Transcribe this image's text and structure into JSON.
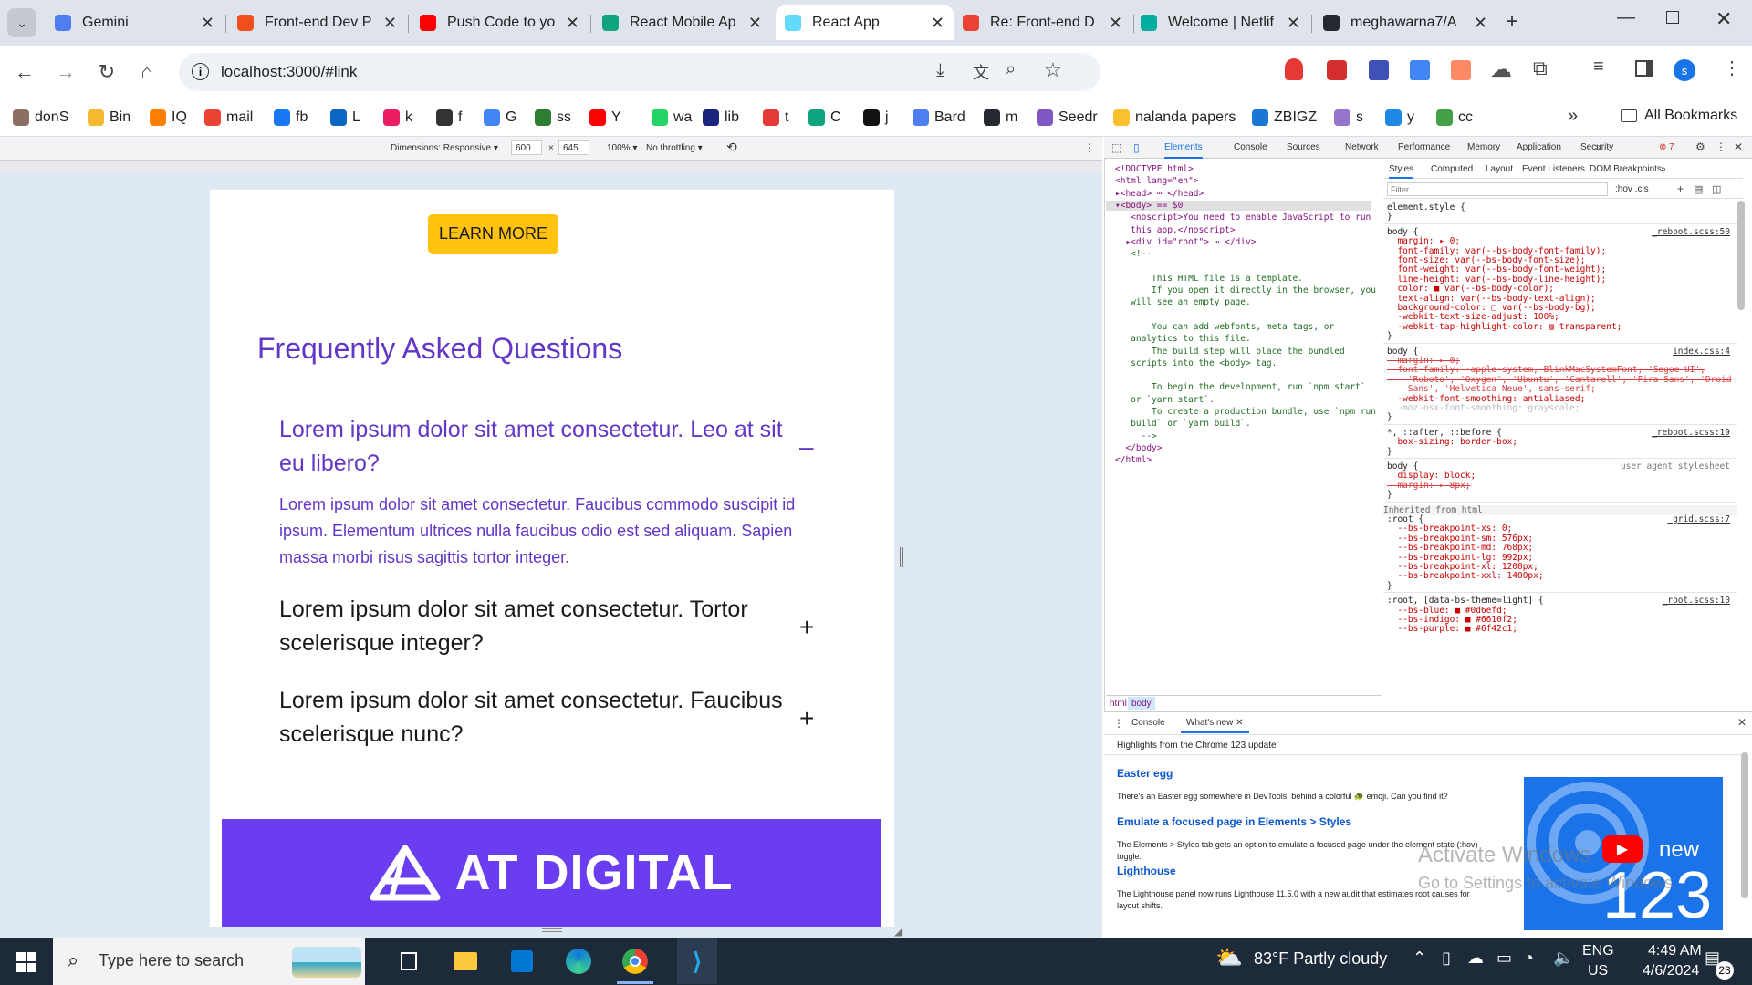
{
  "tabs": [
    {
      "label": "Gemini",
      "icon": "gemini-icon",
      "color": "#4f7df2"
    },
    {
      "label": "Front-end Dev P",
      "icon": "figma-icon",
      "color": "#f24e1e"
    },
    {
      "label": "Push Code to yo",
      "icon": "youtube-icon",
      "color": "#ff0000"
    },
    {
      "label": "React Mobile Ap",
      "icon": "chatgpt-icon",
      "color": "#10a37f"
    },
    {
      "label": "React App",
      "icon": "react-icon",
      "color": "#61dafb"
    },
    {
      "label": "Re: Front-end D",
      "icon": "gmail-icon",
      "color": "#ea4335"
    },
    {
      "label": "Welcome | Netlif",
      "icon": "netlify-icon",
      "color": "#00ad9f"
    },
    {
      "label": "meghawarna7/A",
      "icon": "github-icon",
      "color": "#24292f"
    }
  ],
  "tab_close": "✕",
  "new_tab": "+",
  "address": {
    "url": "localhost:3000/#link"
  },
  "bookmarks": [
    {
      "label": "donS",
      "color": "#8d6e63"
    },
    {
      "label": "Bin",
      "color": "#f3ba2f"
    },
    {
      "label": "IQ",
      "color": "#ff7f00"
    },
    {
      "label": "mail",
      "color": "#ea4335"
    },
    {
      "label": "fb",
      "color": "#1877f2"
    },
    {
      "label": "L",
      "color": "#0a66c2"
    },
    {
      "label": "k",
      "color": "#e91e63"
    },
    {
      "label": "f",
      "color": "#333333"
    },
    {
      "label": "G",
      "color": "#4285f4"
    },
    {
      "label": "ss",
      "color": "#2e7d32"
    },
    {
      "label": "Y",
      "color": "#ff0000"
    },
    {
      "label": "wa",
      "color": "#25d366"
    },
    {
      "label": "lib",
      "color": "#1a237e"
    },
    {
      "label": "t",
      "color": "#e53935"
    },
    {
      "label": "C",
      "color": "#10a37f"
    },
    {
      "label": "j",
      "color": "#111111"
    },
    {
      "label": "Bard",
      "color": "#4f7df2"
    },
    {
      "label": "m",
      "color": "#24292f"
    },
    {
      "label": "Seedr",
      "color": "#7e57c2"
    },
    {
      "label": "nalanda papers",
      "color": "#fbc02d"
    },
    {
      "label": "ZBIGZ",
      "color": "#1976d2"
    },
    {
      "label": "s",
      "color": "#9575cd"
    },
    {
      "label": "y",
      "color": "#1e88e5"
    },
    {
      "label": "cc",
      "color": "#43a047"
    }
  ],
  "all_bookmarks": "All Bookmarks",
  "device_toolbar": {
    "dimensions": "Dimensions: Responsive ▾",
    "width": "600",
    "x": "×",
    "height": "645",
    "zoom": "100% ▾",
    "throttle": "No throttling ▾"
  },
  "page": {
    "learn_more": "LEARN MORE",
    "faq_title": "Frequently Asked Questions",
    "faq": [
      {
        "q": "Lorem ipsum dolor sit amet consectetur. Leo at sit eu libero?",
        "sym": "–",
        "open": true
      },
      {
        "q": "Lorem ipsum dolor sit amet consectetur. Tortor scelerisque integer?",
        "sym": "+",
        "open": false
      },
      {
        "q": "Lorem ipsum dolor sit amet consectetur. Faucibus scelerisque nunc?",
        "sym": "+",
        "open": false
      }
    ],
    "faq_answer": "Lorem ipsum dolor sit amet consectetur. Faucibus commodo suscipit id ipsum. Elementum ultrices nulla faucibus odio est sed aliquam. Sapien massa morbi risus sagittis tortor integer.",
    "banner_text": "AT DIGITAL"
  },
  "devtools": {
    "tabs": [
      "Elements",
      "Console",
      "Sources",
      "Network",
      "Performance",
      "Memory",
      "Application",
      "Security"
    ],
    "more": "»",
    "errors": "7",
    "styles_tabs": [
      "Styles",
      "Computed",
      "Layout",
      "Event Listeners",
      "DOM Breakpoints",
      "»"
    ],
    "filter_placeholder": "Filter",
    "filter_opts": ":hov .cls",
    "elements_lines": [
      "<!DOCTYPE html>",
      "<html lang=\"en\">",
      "▸<head> ⋯ </head>",
      "▾<body> == $0",
      "   <noscript>You need to enable JavaScript to run",
      "   this app.</noscript>",
      "  ▸<div id=\"root\"> ⋯ </div>",
      "   <!--",
      "",
      "       This HTML file is a template.",
      "       If you open it directly in the browser, you",
      "   will see an empty page.",
      "",
      "       You can add webfonts, meta tags, or",
      "   analytics to this file.",
      "       The build step will place the bundled",
      "   scripts into the <body> tag.",
      "",
      "       To begin the development, run `npm start`",
      "   or `yarn start`.",
      "       To create a production bundle, use `npm run",
      "   build` or `yarn build`.",
      "     -->",
      "  </body>",
      "</html>"
    ],
    "breadcrumb": [
      "html",
      "body"
    ],
    "style_rules": [
      {
        "text": "element.style {",
        "src": "",
        "cls": "sel"
      },
      {
        "text": "}",
        "src": "",
        "cls": "sel"
      },
      {
        "text": "body {",
        "src": "_reboot.scss:50",
        "cls": "sel"
      },
      {
        "text": "  margin: ▸ 0;",
        "src": "",
        "cls": "prop"
      },
      {
        "text": "  font-family: var(--bs-body-font-family);",
        "src": "",
        "cls": "prop"
      },
      {
        "text": "  font-size: var(--bs-body-font-size);",
        "src": "",
        "cls": "prop"
      },
      {
        "text": "  font-weight: var(--bs-body-font-weight);",
        "src": "",
        "cls": "prop"
      },
      {
        "text": "  line-height: var(--bs-body-line-height);",
        "src": "",
        "cls": "prop"
      },
      {
        "text": "  color: ■ var(--bs-body-color);",
        "src": "",
        "cls": "prop"
      },
      {
        "text": "  text-align: var(--bs-body-text-align);",
        "src": "",
        "cls": "prop"
      },
      {
        "text": "  background-color: □ var(--bs-body-bg);",
        "src": "",
        "cls": "prop"
      },
      {
        "text": "  -webkit-text-size-adjust: 100%;",
        "src": "",
        "cls": "prop"
      },
      {
        "text": "  -webkit-tap-highlight-color: ▨ transparent;",
        "src": "",
        "cls": "prop"
      },
      {
        "text": "}",
        "src": "",
        "cls": "sel"
      },
      {
        "text": "body {",
        "src": "index.css:4",
        "cls": "sel"
      },
      {
        "text": "  margin: ▸ 0;",
        "src": "",
        "cls": "strike"
      },
      {
        "text": "  font-family: -apple-system, BlinkMacSystemFont, 'Segoe UI',",
        "src": "",
        "cls": "strike"
      },
      {
        "text": "    'Roboto', 'Oxygen', 'Ubuntu', 'Cantarell', 'Fira Sans', 'Droid",
        "src": "",
        "cls": "strike"
      },
      {
        "text": "    Sans', 'Helvetica Neue', sans-serif;",
        "src": "",
        "cls": "strike"
      },
      {
        "text": "  -webkit-font-smoothing: antialiased;",
        "src": "",
        "cls": "prop"
      },
      {
        "text": "  -moz-osx-font-smoothing: grayscale;",
        "src": "",
        "cls": "dim"
      },
      {
        "text": "}",
        "src": "",
        "cls": "sel"
      },
      {
        "text": "*, ::after, ::before {",
        "src": "_reboot.scss:19",
        "cls": "sel"
      },
      {
        "text": "  box-sizing: border-box;",
        "src": "",
        "cls": "prop"
      },
      {
        "text": "}",
        "src": "",
        "cls": "sel"
      },
      {
        "text": "body {",
        "src": "user agent stylesheet",
        "cls": "sel"
      },
      {
        "text": "  display: block;",
        "src": "",
        "cls": "prop"
      },
      {
        "text": "  margin: ▸ 8px;",
        "src": "",
        "cls": "strike"
      },
      {
        "text": "}",
        "src": "",
        "cls": "sel"
      },
      {
        "text": "Inherited from html",
        "src": "",
        "cls": "inh"
      },
      {
        "text": ":root {",
        "src": "_grid.scss:7",
        "cls": "sel"
      },
      {
        "text": "  --bs-breakpoint-xs: 0;",
        "src": "",
        "cls": "prop"
      },
      {
        "text": "  --bs-breakpoint-sm: 576px;",
        "src": "",
        "cls": "prop"
      },
      {
        "text": "  --bs-breakpoint-md: 768px;",
        "src": "",
        "cls": "prop"
      },
      {
        "text": "  --bs-breakpoint-lg: 992px;",
        "src": "",
        "cls": "prop"
      },
      {
        "text": "  --bs-breakpoint-xl: 1200px;",
        "src": "",
        "cls": "prop"
      },
      {
        "text": "  --bs-breakpoint-xxl: 1400px;",
        "src": "",
        "cls": "prop"
      },
      {
        "text": "}",
        "src": "",
        "cls": "sel"
      },
      {
        "text": ":root, [data-bs-theme=light] {",
        "src": "_root.scss:10",
        "cls": "sel"
      },
      {
        "text": "  --bs-blue: ■ #0d6efd;",
        "src": "",
        "cls": "prop"
      },
      {
        "text": "  --bs-indigo: ■ #6610f2;",
        "src": "",
        "cls": "prop"
      },
      {
        "text": "  --bs-purple: ■ #6f42c1;",
        "src": "",
        "cls": "prop"
      }
    ],
    "drawer_tabs": [
      "Console",
      "What's new"
    ],
    "drawer_headline": "Highlights from the Chrome 123 update",
    "news": [
      {
        "title": "Easter egg",
        "body": "There's an Easter egg somewhere in DevTools, behind a colorful 🐢 emoji. Can you find it?"
      },
      {
        "title": "Emulate a focused page in Elements > Styles",
        "body": "The Elements > Styles tab gets an option to emulate a focused page under the element state (:hov) toggle."
      },
      {
        "title": "Lighthouse",
        "body": "The Lighthouse panel now runs Lighthouse 11.5.0 with a new audit that estimates root causes for layout shifts."
      }
    ],
    "promo": {
      "new": "new",
      "num": "123"
    },
    "watermark": [
      "Activate Windows",
      "Go to Settings to activate Windows."
    ]
  },
  "taskbar": {
    "search_placeholder": "Type here to search",
    "weather": "83°F  Partly cloudy",
    "lang": [
      "ENG",
      "US"
    ],
    "time": "4:49 AM",
    "date": "4/6/2024",
    "notif": "23"
  }
}
